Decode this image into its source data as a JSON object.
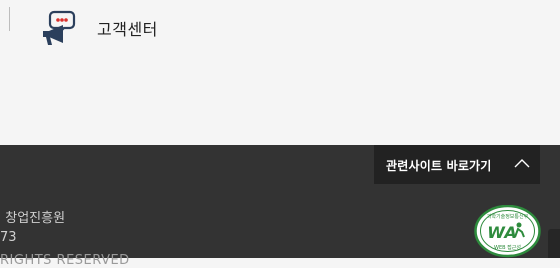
{
  "customer_center": {
    "label": "고객센터",
    "icon": "megaphone-speech-bubble-icon"
  },
  "footer": {
    "related_sites": {
      "label": "관련사이트 바로가기",
      "icon": "chevron-up-icon"
    },
    "org_name": "· 창업진흥원",
    "number_line": "73",
    "copyright": "RIGHTS RESERVED",
    "wa_mark": {
      "text_top": "과학기술정보통신부",
      "text_mid": "WA",
      "text_bottom": "WEB 접근성"
    }
  },
  "colors": {
    "footer_bg": "#333333",
    "button_bg": "#222222",
    "icon_navy": "#2b3f5c",
    "accent_red": "#d9302c",
    "wa_green": "#2e8b3d"
  }
}
